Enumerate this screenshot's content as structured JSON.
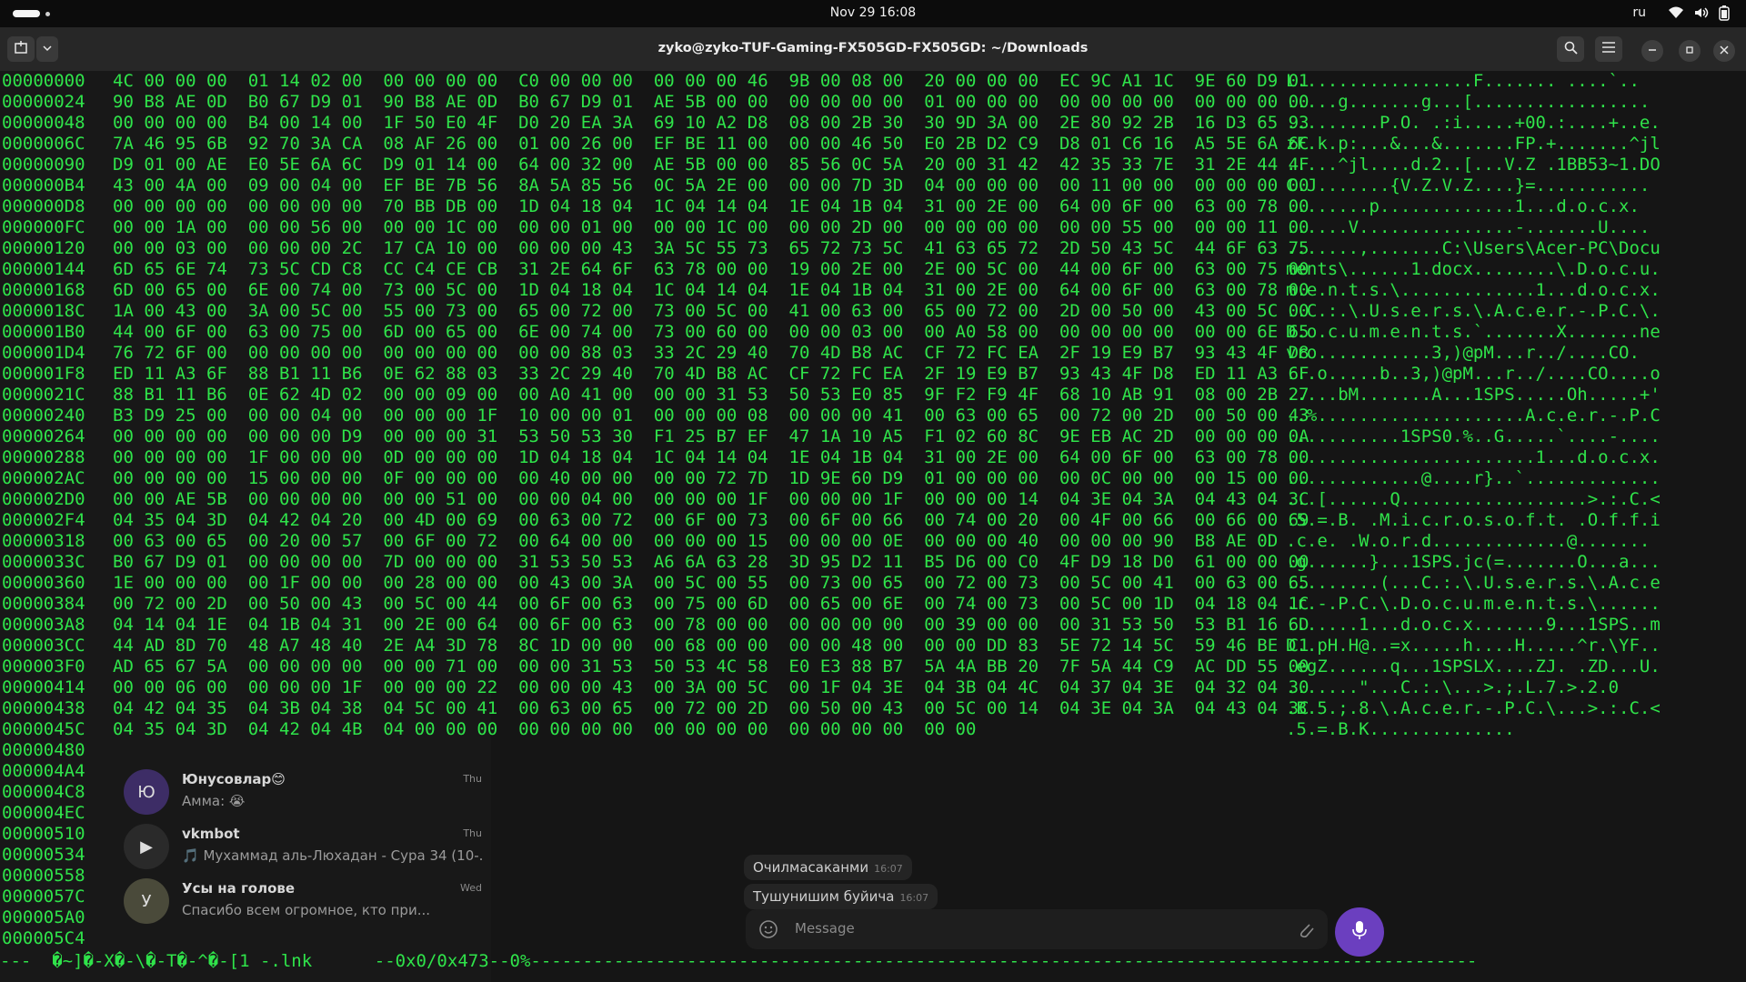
{
  "top_bar": {
    "datetime": "Nov 29  16:08",
    "input_language": "ru"
  },
  "window": {
    "title": "zyko@zyko-TUF-Gaming-FX505GD-FX505GD: ~/Downloads"
  },
  "telegram_background": {
    "chats": [
      {
        "name": "Юнусовлар😊",
        "preview": "Амма: 😭",
        "time": "Thu",
        "avatar": "Ю"
      },
      {
        "name": "vkmbot",
        "preview": "🎵 Мухаммад аль-Люхадан - Сура 34 (10-...",
        "time": "Thu",
        "avatar": "▶"
      },
      {
        "name": "Усы на голове",
        "preview": "Спасибо всем огромное, кто при...",
        "time": "Wed",
        "avatar": "У"
      }
    ],
    "messages": [
      {
        "text": "Очилмасаканми",
        "time": "16:07"
      },
      {
        "text": "Тушунишим буйича",
        "time": "16:07"
      }
    ],
    "composer_placeholder": "Message"
  },
  "hexview": {
    "rows": [
      {
        "offset": "00000000",
        "hex": "4C 00 00 00  01 14 02 00  00 00 00 00  C0 00 00 00  00 00 00 46  9B 00 08 00  20 00 00 00  EC 9C A1 1C  9E 60 D9 01",
        "ascii": "L.................F....... ....`.."
      },
      {
        "offset": "00000024",
        "hex": "90 B8 AE 0D  B0 67 D9 01  90 B8 AE 0D  B0 67 D9 01  AE 5B 00 00  00 00 00 00  01 00 00 00  00 00 00 00  00 00 00 00",
        "ascii": ".....g.......g...[................."
      },
      {
        "offset": "00000048",
        "hex": "00 00 00 00  B4 00 14 00  1F 50 E0 4F  D0 20 EA 3A  69 10 A2 D8  08 00 2B 30  30 9D 3A 00  2E 80 92 2B  16 D3 65 93",
        "ascii": ".........P.O. .:i.....+00.:....+..e."
      },
      {
        "offset": "0000006C",
        "hex": "7A 46 95 6B  92 70 3A CA  08 AF 26 00  01 00 26 00  EF BE 11 00  00 00 46 50  E0 2B D2 C9  D8 01 C6 16  A5 5E 6A 6C",
        "ascii": "zF.k.p:...&...&.......FP.+.......^jl"
      },
      {
        "offset": "00000090",
        "hex": "D9 01 00 AE  E0 5E 6A 6C  D9 01 14 00  64 00 32 00  AE 5B 00 00  85 56 0C 5A  20 00 31 42  42 35 33 7E  31 2E 44 4F",
        "ascii": ".....^jl....d.2..[...V.Z .1BB53~1.DO"
      },
      {
        "offset": "000000B4",
        "hex": "43 00 4A 00  09 00 04 00  EF BE 7B 56  8A 5A 85 56  0C 5A 2E 00  00 00 7D 3D  04 00 00 00  00 11 00 00  00 00 00 00",
        "ascii": "C.J.......{V.Z.V.Z....}=..........."
      },
      {
        "offset": "000000D8",
        "hex": "00 00 00 00  00 00 00 00  70 BB DB 00  1D 04 18 04  1C 04 14 04  1E 04 1B 04  31 00 2E 00  64 00 6F 00  63 00 78 00",
        "ascii": "........p.............1...d.o.c.x."
      },
      {
        "offset": "000000FC",
        "hex": "00 00 1A 00  00 00 56 00  00 00 1C 00  00 00 01 00  00 00 1C 00  00 00 2D 00  00 00 00 00  00 00 55 00  00 00 11 00",
        "ascii": "......V...............-.......U...."
      },
      {
        "offset": "00000120",
        "hex": "00 00 03 00  00 00 00 2C  17 CA 10 00  00 00 00 43  3A 5C 55 73  65 72 73 5C  41 63 65 72  2D 50 43 5C  44 6F 63 75",
        "ascii": ".......,.......C:\\Users\\Acer-PC\\Docu"
      },
      {
        "offset": "00000144",
        "hex": "6D 65 6E 74  73 5C CD C8  CC C4 CE CB  31 2E 64 6F  63 78 00 00  19 00 2E 00  2E 00 5C 00  44 00 6F 00  63 00 75 00",
        "ascii": "ments\\......1.docx........\\.D.o.c.u."
      },
      {
        "offset": "00000168",
        "hex": "6D 00 65 00  6E 00 74 00  73 00 5C 00  1D 04 18 04  1C 04 14 04  1E 04 1B 04  31 00 2E 00  64 00 6F 00  63 00 78 00",
        "ascii": "m.e.n.t.s.\\.............1...d.o.c.x."
      },
      {
        "offset": "0000018C",
        "hex": "1A 00 43 00  3A 00 5C 00  55 00 73 00  65 00 72 00  73 00 5C 00  41 00 63 00  65 00 72 00  2D 00 50 00  43 00 5C 00",
        "ascii": "..C.:.\\.U.s.e.r.s.\\.A.c.e.r.-.P.C.\\."
      },
      {
        "offset": "000001B0",
        "hex": "44 00 6F 00  63 00 75 00  6D 00 65 00  6E 00 74 00  73 00 60 00  00 00 03 00  00 A0 58 00  00 00 00 00  00 00 6E 65",
        "ascii": "D.o.c.u.m.e.n.t.s.`.......X.......ne"
      },
      {
        "offset": "000001D4",
        "hex": "76 72 6F 00  00 00 00 00  00 00 00 00  00 00 88 03  33 2C 29 40  70 4D B8 AC  CF 72 FC EA  2F 19 E9 B7  93 43 4F D8",
        "ascii": "vro...........3,)@pM...r../....CO."
      },
      {
        "offset": "000001F8",
        "hex": "ED 11 A3 6F  88 B1 11 B6  0E 62 88 03  33 2C 29 40  70 4D B8 AC  CF 72 FC EA  2F 19 E9 B7  93 43 4F D8  ED 11 A3 6F",
        "ascii": "...o.....b..3,)@pM...r../....CO....o"
      },
      {
        "offset": "0000021C",
        "hex": "88 B1 11 B6  0E 62 4D 02  00 00 09 00  00 A0 41 00  00 00 31 53  50 53 E0 85  9F F2 F9 4F  68 10 AB 91  08 00 2B 27",
        "ascii": ".....bM.......A...1SPS.....Oh.....+'"
      },
      {
        "offset": "00000240",
        "hex": "B3 D9 25 00  00 00 04 00  00 00 00 1F  10 00 00 01  00 00 00 08  00 00 00 41  00 63 00 65  00 72 00 2D  00 50 00 43",
        "ascii": "..%....................A.c.e.r.-.P.C"
      },
      {
        "offset": "00000264",
        "hex": "00 00 00 00  00 00 00 D9  00 00 00 31  53 50 53 30  F1 25 B7 EF  47 1A 10 A5  F1 02 60 8C  9E EB AC 2D  00 00 00 0A",
        "ascii": "...........1SPS0.%..G.....`....-...."
      },
      {
        "offset": "00000288",
        "hex": "00 00 00 00  1F 00 00 00  0D 00 00 00  1D 04 18 04  1C 04 14 04  1E 04 1B 04  31 00 2E 00  64 00 6F 00  63 00 78 00",
        "ascii": "........................1...d.o.c.x."
      },
      {
        "offset": "000002AC",
        "hex": "00 00 00 00  15 00 00 00  0F 00 00 00  00 40 00 00  00 00 72 7D  1D 9E 60 D9  01 00 00 00  00 0C 00 00  00 15 00 00",
        "ascii": ".............@....r}..`............."
      },
      {
        "offset": "000002D0",
        "hex": "00 00 AE 5B  00 00 00 00  00 00 51 00  00 00 04 00  00 00 00 1F  00 00 00 1F  00 00 00 14  04 3E 04 3A  04 43 04 3C",
        "ascii": "...[......Q..................>.:.C.<"
      },
      {
        "offset": "000002F4",
        "hex": "04 35 04 3D  04 42 04 20  00 4D 00 69  00 63 00 72  00 6F 00 73  00 6F 00 66  00 74 00 20  00 4F 00 66  00 66 00 69",
        "ascii": ".5.=.B. .M.i.c.r.o.s.o.f.t. .O.f.f.i"
      },
      {
        "offset": "00000318",
        "hex": "00 63 00 65  00 20 00 57  00 6F 00 72  00 64 00 00  00 00 00 15  00 00 00 0E  00 00 00 40  00 00 00 90  B8 AE 0D",
        "ascii": ".c.e. .W.o.r.d.............@......."
      },
      {
        "offset": "0000033C",
        "hex": "B0 67 D9 01  00 00 00 00  7D 00 00 00  31 53 50 53  A6 6A 63 28  3D 95 D2 11  B5 D6 00 C0  4F D9 18 D0  61 00 00 00",
        "ascii": ".g......}...1SPS.jc(=.......O...a..."
      },
      {
        "offset": "00000360",
        "hex": "1E 00 00 00  00 1F 00 00  00 28 00 00  00 43 00 3A  00 5C 00 55  00 73 00 65  00 72 00 73  00 5C 00 41  00 63 00 65",
        "ascii": ".........(...C.:.\\.U.s.e.r.s.\\.A.c.e"
      },
      {
        "offset": "00000384",
        "hex": "00 72 00 2D  00 50 00 43  00 5C 00 44  00 6F 00 63  00 75 00 6D  00 65 00 6E  00 74 00 73  00 5C 00 1D  04 18 04 1C",
        "ascii": ".r.-.P.C.\\.D.o.c.u.m.e.n.t.s.\\......"
      },
      {
        "offset": "000003A8",
        "hex": "04 14 04 1E  04 1B 04 31  00 2E 00 64  00 6F 00 63  00 78 00 00  00 00 00 00  00 39 00 00  00 31 53 50  53 B1 16 6D",
        "ascii": ".......1...d.o.c.x.......9...1SPS..m"
      },
      {
        "offset": "000003CC",
        "hex": "44 AD 8D 70  48 A7 48 40  2E A4 3D 78  8C 1D 00 00  00 68 00 00  00 00 48 00  00 00 DD 83  5E 72 14 5C  59 46 BE C1",
        "ascii": "D..pH.H@..=x.....h....H.....^r.\\YF.."
      },
      {
        "offset": "000003F0",
        "hex": "AD 65 67 5A  00 00 00 00  00 00 71 00  00 00 31 53  50 53 4C 58  E0 E3 88 B7  5A 4A BB 20  7F 5A 44 C9  AC DD 55 00",
        "ascii": ".egZ......q...1SPSLX....ZJ. .ZD...U."
      },
      {
        "offset": "00000414",
        "hex": "00 00 06 00  00 00 00 1F  00 00 00 22  00 00 00 43  00 3A 00 5C  00 1F 04 3E  04 3B 04 4C  04 37 04 3E  04 32 04 30",
        "ascii": ".......\"...C.:.\\...>.;.L.7.>.2.0"
      },
      {
        "offset": "00000438",
        "hex": "04 42 04 35  04 3B 04 38  04 5C 00 41  00 63 00 65  00 72 00 2D  00 50 00 43  00 5C 00 14  04 3E 04 3A  04 43 04 3C",
        "ascii": ".B.5.;.8.\\.A.c.e.r.-.P.C.\\...>.:.C.<"
      },
      {
        "offset": "0000045C",
        "hex": "04 35 04 3D  04 42 04 4B  04 00 00 00  00 00 00 00  00 00 00 00  00 00 00 00  00 00",
        "ascii": ".5.=.B.K.............."
      },
      {
        "offset": "00000480",
        "hex": "",
        "ascii": ""
      },
      {
        "offset": "000004A4",
        "hex": "",
        "ascii": ""
      },
      {
        "offset": "000004C8",
        "hex": "",
        "ascii": ""
      },
      {
        "offset": "000004EC",
        "hex": "",
        "ascii": ""
      },
      {
        "offset": "00000510",
        "hex": "",
        "ascii": ""
      },
      {
        "offset": "00000534",
        "hex": "",
        "ascii": ""
      },
      {
        "offset": "00000558",
        "hex": "",
        "ascii": ""
      },
      {
        "offset": "0000057C",
        "hex": "",
        "ascii": ""
      },
      {
        "offset": "000005A0",
        "hex": "",
        "ascii": ""
      },
      {
        "offset": "000005C4",
        "hex": "",
        "ascii": ""
      }
    ],
    "status_line": "---  �~]�-X�-\\�-T�-^�-[1 -.lnk      --0x0/0x473--0%-------------------------------------------------------------------------------------------"
  }
}
